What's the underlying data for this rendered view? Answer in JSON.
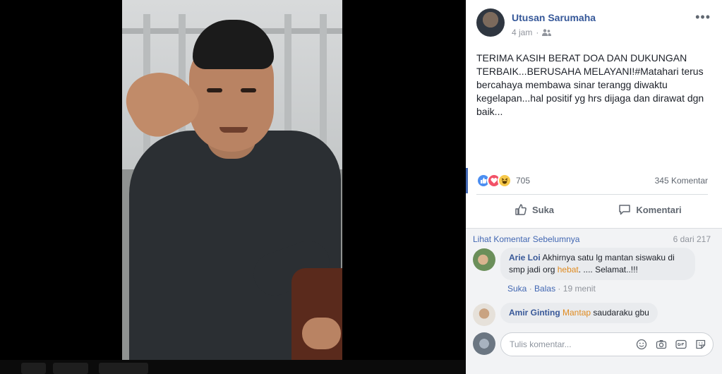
{
  "post": {
    "author": "Utusan Sarumaha",
    "time": "4 jam",
    "separator": "·",
    "more_label": "•••",
    "text": "TERIMA KASIH BERAT DOA DAN DUKUNGAN TERBAIK...BERUSAHA MELAYANI!#Matahari terus bercahaya membawa sinar terangg diwaktu kegelapan...hal positif yg hrs dijaga dan dirawat dgn baik...",
    "reaction_count": "705",
    "comment_count": "345 Komentar",
    "like_label": "Suka",
    "comment_label": "Komentari"
  },
  "comments": {
    "prev_link": "Lihat Komentar Sebelumnya",
    "count_of": "6 dari 217",
    "items": [
      {
        "name": "Arie Loi",
        "text_before": "Akhirnya satu lg mantan siswaku di smp jadi org",
        "highlight": "hebat",
        "text_after": ". .... Selamat..!!!",
        "like": "Suka",
        "sep": "·",
        "reply": "Balas",
        "time": "19 menit"
      },
      {
        "name": "Amir Ginting",
        "highlight": "Mantap",
        "text_after": "saudaraku gbu"
      }
    ],
    "compose_placeholder": "Tulis komentar..."
  },
  "icons": {
    "reaction_like": "like-icon",
    "reaction_love": "love-icon",
    "reaction_haha": "haha-icon",
    "audience": "friends-icon"
  },
  "colors": {
    "link": "#365899",
    "accent": "#4267b2",
    "highlight": "#e08a1e"
  }
}
